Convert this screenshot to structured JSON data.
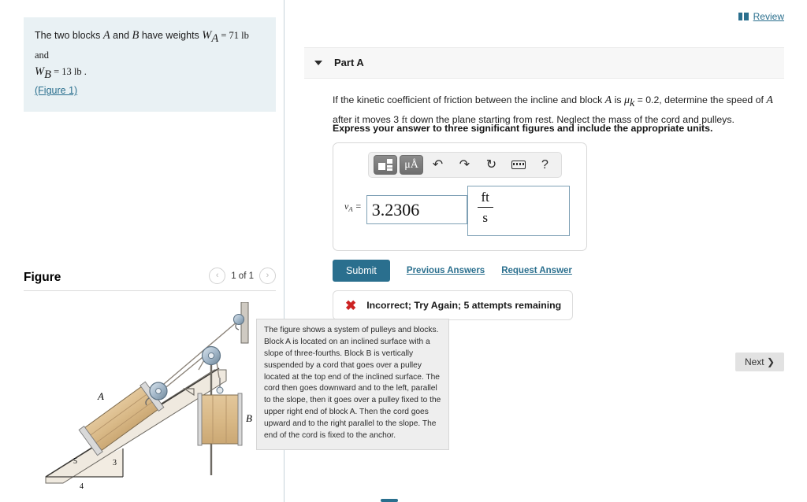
{
  "left_panel": {
    "problem_statement": {
      "line1_pre": "The two blocks ",
      "var_a": "A",
      "line1_mid": " and ",
      "var_b": "B",
      "line1_post": " have weights ",
      "w_a_symbol": "W",
      "w_a_sub": "A",
      "w_a_value": " = 71 lb and",
      "w_b_symbol": "W",
      "w_b_sub": "B",
      "w_b_value": " = 13 lb .",
      "figure_link": "(Figure 1)"
    },
    "figure_section": {
      "title": "Figure",
      "pager_label": "1 of 1",
      "prev_icon": "‹",
      "next_icon": "›"
    },
    "figure_labels": {
      "block_a": "A",
      "block_b": "B",
      "slope_hyp": "5",
      "slope_rise": "3",
      "slope_run": "4"
    }
  },
  "header": {
    "review_label": "Review",
    "review_icon": "book-icon"
  },
  "part": {
    "title": "Part A",
    "caret_icon": "caret-down-icon",
    "question_pre": "If the kinetic coefficient of friction between the incline and block ",
    "question_var_a": "A",
    "question_mid": " is ",
    "question_mu": "μ",
    "question_mu_sub": "k",
    "question_mu_value": " = 0.2, determine the speed of ",
    "question_var_a2": "A",
    "question_post": " after it moves 3 ",
    "question_unit": "ft",
    "question_tail": " down the plane starting from rest. Neglect the mass of the cord and pulleys.",
    "instruction": "Express your answer to three significant figures and include the appropriate units."
  },
  "answer_widget": {
    "toolbar": [
      {
        "name": "template-icon",
        "label": "",
        "active": true
      },
      {
        "name": "units-mu-angstrom-icon",
        "label": "μÅ",
        "active": true
      },
      {
        "name": "undo-icon",
        "label": "↶"
      },
      {
        "name": "redo-icon",
        "label": "↷"
      },
      {
        "name": "reset-icon",
        "label": "↻"
      },
      {
        "name": "keyboard-icon",
        "label": ""
      },
      {
        "name": "help-icon",
        "label": "?"
      }
    ],
    "answer_label_symbol": "v",
    "answer_label_sub": "A",
    "answer_label_eq": " =",
    "value": "3.2306",
    "placeholder": "",
    "units_numerator": "ft",
    "units_denominator": "s"
  },
  "actions": {
    "submit_label": "Submit",
    "previous_answers_label": "Previous Answers",
    "request_answer_label": "Request Answer",
    "next_label": "Next",
    "next_icon": "❯"
  },
  "feedback": {
    "icon": "✖",
    "icon_color": "#cc2222",
    "text": "Incorrect; Try Again; 5 attempts remaining"
  },
  "tooltip": {
    "text": "The figure shows a system of pulleys and blocks. Block A is located on an inclined surface with a slope of three-fourths. Block B is vertically suspended by a cord that goes over a pulley located at the top end of the inclined surface. The cord then goes downward and to the left, parallel to the slope, then it goes over a pulley fixed to the upper right end of block A. Then the cord goes upward and to the right parallel to the slope. The end of the cord is fixed to the anchor."
  },
  "colors": {
    "accent": "#2a6f8e",
    "prompt_bg": "#e9f1f4",
    "error": "#cc2222",
    "panel_header_bg": "#f7f7f7"
  }
}
